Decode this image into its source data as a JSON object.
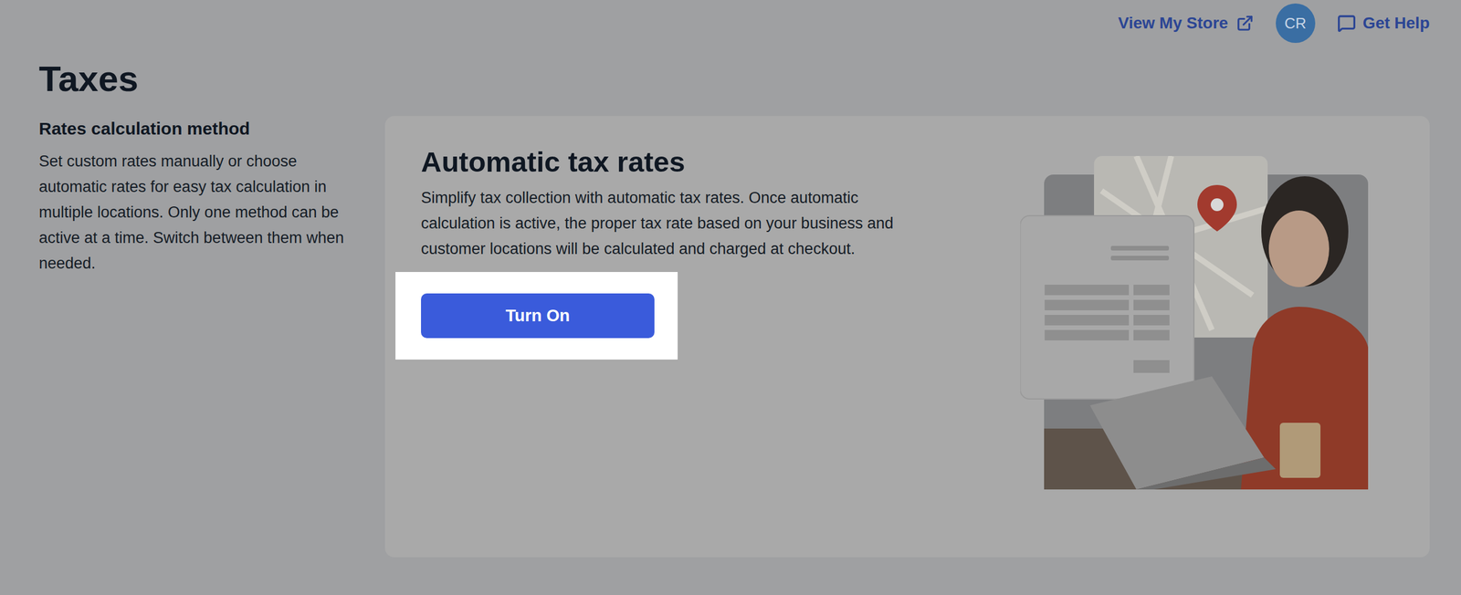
{
  "top_bar": {
    "store_link": "View My Store",
    "avatar": "CR",
    "help_link": "Get Help"
  },
  "page": {
    "title": "Taxes"
  },
  "section": {
    "title": "Rates calculation method",
    "description": "Set custom rates manually or choose automatic rates for easy tax calculation in multiple locations. Only one method can be active at a time. Switch between them when needed."
  },
  "card": {
    "title": "Automatic tax rates",
    "description": "Simplify tax collection with automatic tax rates. Once automatic calculation is active, the proper tax rate based on your business and customer locations will be calculated and charged at checkout.",
    "button": {
      "label": "Turn On",
      "highlighted": true
    }
  }
}
